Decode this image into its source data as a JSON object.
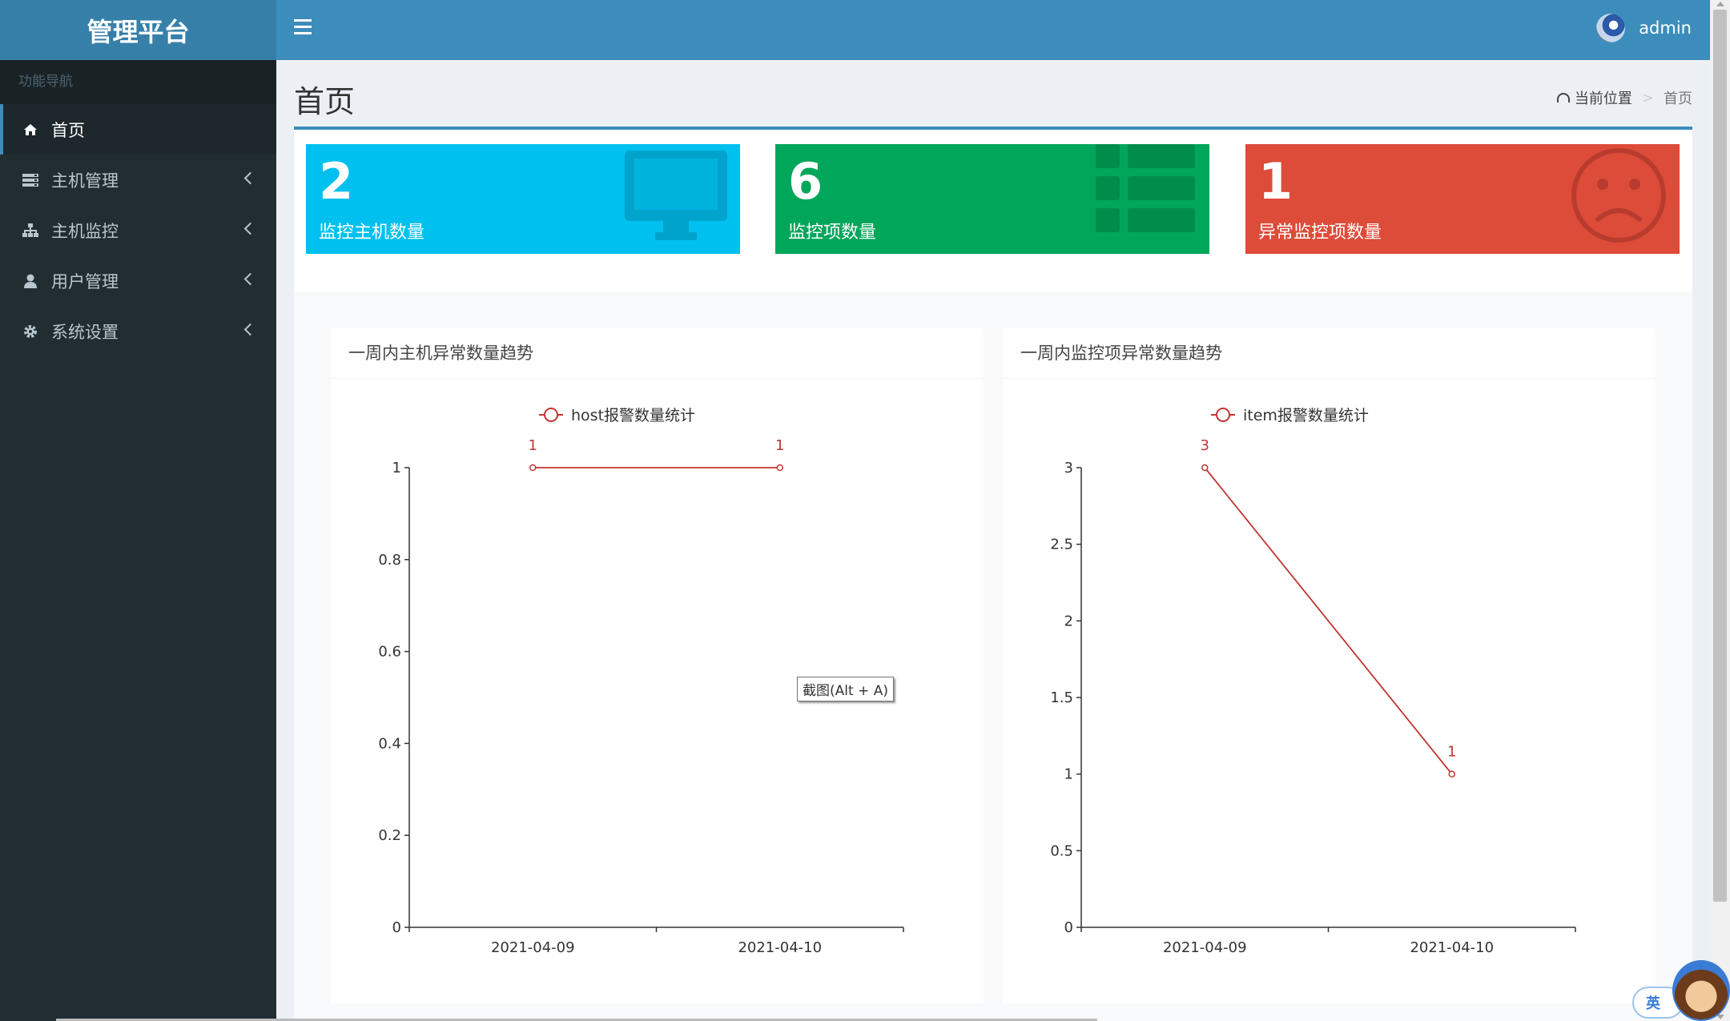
{
  "app": {
    "logo_text": "管理平台"
  },
  "header": {
    "username": "admin"
  },
  "sidebar": {
    "header": "功能导航",
    "items": [
      {
        "label": "首页",
        "icon": "home-icon",
        "active": true
      },
      {
        "label": "主机管理",
        "icon": "server-icon"
      },
      {
        "label": "主机监控",
        "icon": "sitemap-icon"
      },
      {
        "label": "用户管理",
        "icon": "user-icon"
      },
      {
        "label": "系统设置",
        "icon": "gear-icon"
      }
    ]
  },
  "page": {
    "title": "首页",
    "breadcrumb": {
      "label": "当前位置",
      "separator": ">",
      "current": "首页"
    }
  },
  "stats": [
    {
      "value": "2",
      "label": "监控主机数量",
      "color": "#00c0ef",
      "icon": "desktop-icon"
    },
    {
      "value": "6",
      "label": "监控项数量",
      "color": "#00a65a",
      "icon": "table-icon"
    },
    {
      "value": "1",
      "label": "异常监控项数量",
      "color": "#dd4b39",
      "icon": "frown-icon"
    }
  ],
  "charts": {
    "host": {
      "title": "一周内主机异常数量趋势"
    },
    "item": {
      "title": "一周内监控项异常数量趋势"
    }
  },
  "chart_data": [
    {
      "type": "line",
      "title": "一周内主机异常数量趋势",
      "categories": [
        "2021-04-09",
        "2021-04-10"
      ],
      "series": [
        {
          "name": "host报警数量统计",
          "values": [
            1,
            1
          ],
          "color": "#c23531"
        }
      ],
      "ylim": [
        0,
        1
      ],
      "yticks": [
        "0",
        "0.2",
        "0.4",
        "0.6",
        "0.8",
        "1"
      ],
      "legend": "top-center",
      "grid": false
    },
    {
      "type": "line",
      "title": "一周内监控项异常数量趋势",
      "categories": [
        "2021-04-09",
        "2021-04-10"
      ],
      "series": [
        {
          "name": "item报警数量统计",
          "values": [
            3,
            1
          ],
          "color": "#c23531"
        }
      ],
      "ylim": [
        0,
        3
      ],
      "yticks": [
        "0",
        "0.5",
        "1",
        "1.5",
        "2",
        "2.5",
        "3"
      ],
      "legend": "top-center",
      "grid": false
    }
  ],
  "overlay": {
    "screenshot_tip": "截图(Alt + A)",
    "ime_label": "英"
  }
}
